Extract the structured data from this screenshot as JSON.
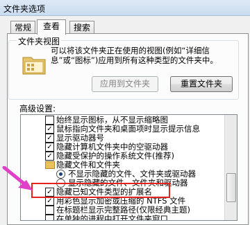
{
  "window": {
    "title": "文件夹选项"
  },
  "tabs": [
    {
      "label": "常规"
    },
    {
      "label": "查看",
      "active": true
    },
    {
      "label": "搜索"
    }
  ],
  "folder_views": {
    "group_title": "文件夹视图",
    "description": "可以将该文件夹正在使用的视图(例如“详细信息”或“图标”)应用到所有这种类型的文件夹中。",
    "apply_button": "应用到文件夹",
    "reset_button": "重置文件夹"
  },
  "advanced": {
    "title": "高级设置:",
    "items": [
      {
        "type": "checkbox",
        "checked": false,
        "label": "始终显示图标，从不显示缩略图"
      },
      {
        "type": "checkbox",
        "checked": true,
        "label": "鼠标指向文件夹和桌面项时显示提示信息"
      },
      {
        "type": "checkbox",
        "checked": true,
        "label": "显示驱动器号"
      },
      {
        "type": "checkbox",
        "checked": true,
        "label": "隐藏计算机文件夹中的空驱动器"
      },
      {
        "type": "checkbox",
        "checked": true,
        "label": "隐藏受保护的操作系统文件(推荐)"
      },
      {
        "type": "folder",
        "label": "隐藏文件和文件夹"
      },
      {
        "type": "radio",
        "checked": true,
        "label": "不显示隐藏的文件、文件夹或驱动器"
      },
      {
        "type": "radio",
        "checked": false,
        "label": "显示隐藏的文件、文件夹和驱动器"
      },
      {
        "type": "checkbox",
        "checked": true,
        "label": "隐藏已知文件类型的扩展名"
      },
      {
        "type": "checkbox",
        "checked": true,
        "label": "用彩色显示加密或压缩的 NTFS 文件"
      },
      {
        "type": "checkbox",
        "checked": false,
        "label": "在标题栏显示完整路径(仅限经典主题)"
      },
      {
        "type": "checkbox",
        "checked": false,
        "label": "在单独的进程中打开文件夹窗口"
      }
    ]
  },
  "colors": {
    "highlight": "#e3231c",
    "arrow": "#e040c8"
  }
}
